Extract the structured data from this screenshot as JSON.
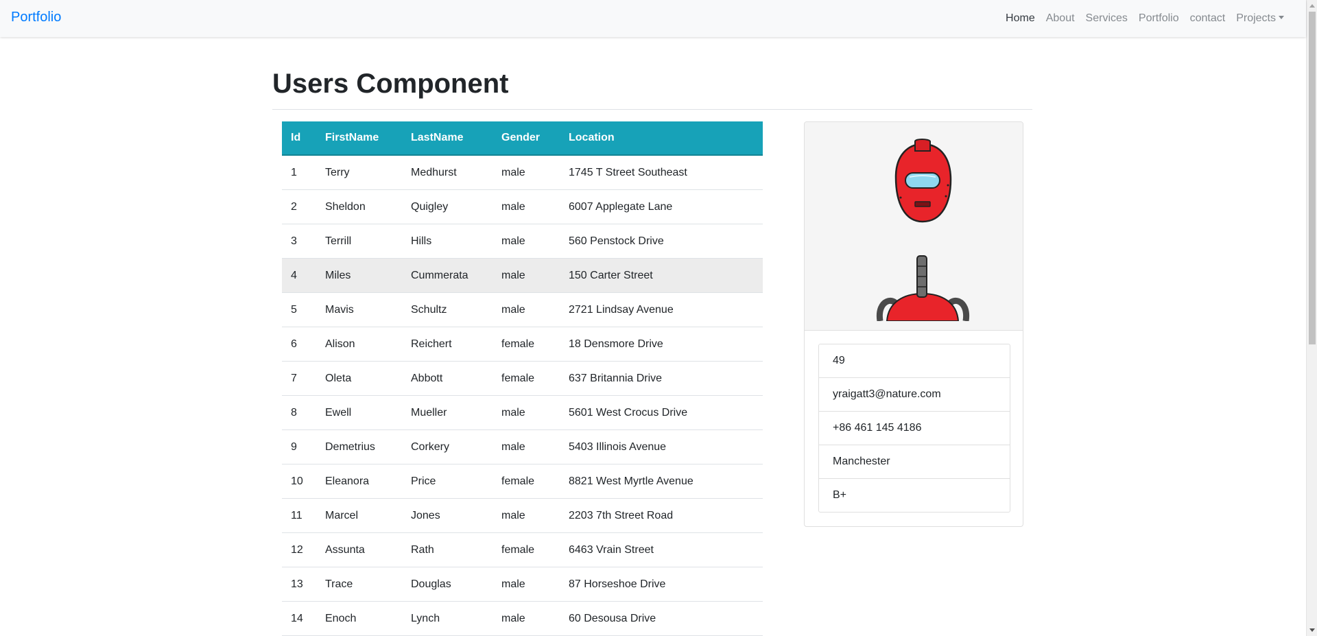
{
  "navbar": {
    "brand": "Portfolio",
    "links": [
      "Home",
      "About",
      "Services",
      "Portfolio",
      "contact",
      "Projects"
    ]
  },
  "page": {
    "title": "Users Component"
  },
  "table": {
    "headers": [
      "Id",
      "FirstName",
      "LastName",
      "Gender",
      "Location"
    ],
    "rows": [
      [
        "1",
        "Terry",
        "Medhurst",
        "male",
        "1745 T Street Southeast"
      ],
      [
        "2",
        "Sheldon",
        "Quigley",
        "male",
        "6007 Applegate Lane"
      ],
      [
        "3",
        "Terrill",
        "Hills",
        "male",
        "560 Penstock Drive"
      ],
      [
        "4",
        "Miles",
        "Cummerata",
        "male",
        "150 Carter Street"
      ],
      [
        "5",
        "Mavis",
        "Schultz",
        "male",
        "2721 Lindsay Avenue"
      ],
      [
        "6",
        "Alison",
        "Reichert",
        "female",
        "18 Densmore Drive"
      ],
      [
        "7",
        "Oleta",
        "Abbott",
        "female",
        "637 Britannia Drive"
      ],
      [
        "8",
        "Ewell",
        "Mueller",
        "male",
        "5601 West Crocus Drive"
      ],
      [
        "9",
        "Demetrius",
        "Corkery",
        "male",
        "5403 Illinois Avenue"
      ],
      [
        "10",
        "Eleanora",
        "Price",
        "female",
        "8821 West Myrtle Avenue"
      ],
      [
        "11",
        "Marcel",
        "Jones",
        "male",
        "2203 7th Street Road"
      ],
      [
        "12",
        "Assunta",
        "Rath",
        "female",
        "6463 Vrain Street"
      ],
      [
        "13",
        "Trace",
        "Douglas",
        "male",
        "87 Horseshoe Drive"
      ],
      [
        "14",
        "Enoch",
        "Lynch",
        "male",
        "60 Desousa Drive"
      ]
    ]
  },
  "detail": {
    "image_icon": "robot-avatar",
    "age": "49",
    "email": "yraigatt3@nature.com",
    "phone": "+86 461 145 4186",
    "city": "Manchester",
    "blood_group": "B+"
  },
  "colors": {
    "brand": "#007bff",
    "table_header": "#17a2b8",
    "navbar_bg": "#f8f9fa"
  }
}
